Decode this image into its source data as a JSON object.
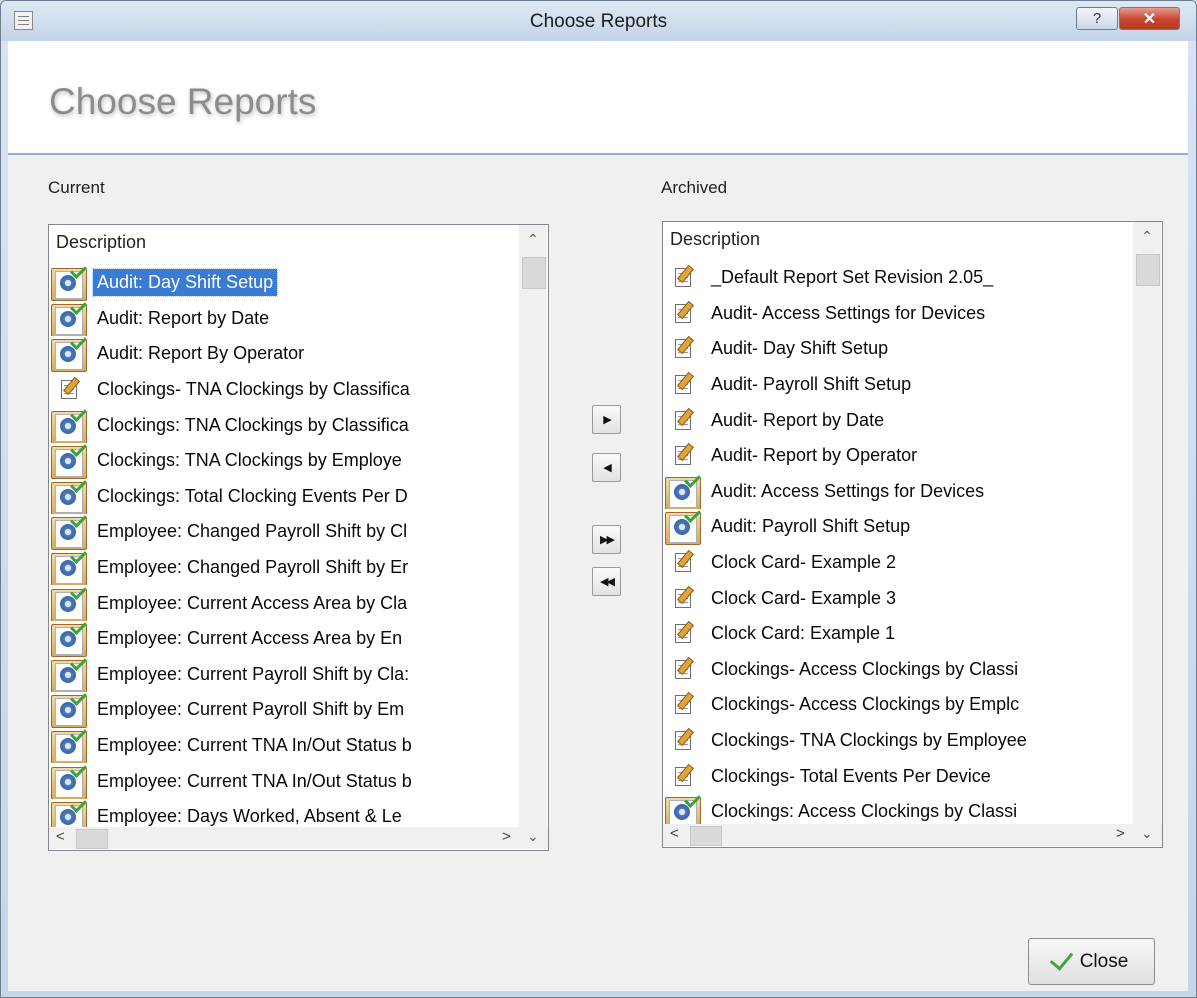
{
  "window": {
    "title": "Choose Reports",
    "help_label": "?",
    "close_label": "✕"
  },
  "header": {
    "title": "Choose Reports"
  },
  "current": {
    "label": "Current",
    "column_header": "Description",
    "items": [
      {
        "icon": "report-check-icon",
        "label": "Audit: Day Shift Setup",
        "selected": true
      },
      {
        "icon": "report-check-icon",
        "label": "Audit: Report by Date"
      },
      {
        "icon": "report-check-icon",
        "label": "Audit: Report By Operator"
      },
      {
        "icon": "report-edit-icon",
        "label": "Clockings- TNA Clockings by Classifica"
      },
      {
        "icon": "report-check-icon",
        "label": "Clockings: TNA Clockings by Classifica"
      },
      {
        "icon": "report-check-icon",
        "label": "Clockings: TNA Clockings by Employe"
      },
      {
        "icon": "report-check-icon",
        "label": "Clockings: Total Clocking Events Per D"
      },
      {
        "icon": "report-check-icon",
        "label": "Employee: Changed Payroll Shift by Cl"
      },
      {
        "icon": "report-check-icon",
        "label": "Employee: Changed Payroll Shift by Er"
      },
      {
        "icon": "report-check-icon",
        "label": "Employee: Current Access Area by Cla"
      },
      {
        "icon": "report-check-icon",
        "label": "Employee: Current Access Area by En"
      },
      {
        "icon": "report-check-icon",
        "label": "Employee: Current Payroll Shift by Cla:"
      },
      {
        "icon": "report-check-icon",
        "label": "Employee: Current Payroll Shift by Em"
      },
      {
        "icon": "report-check-icon",
        "label": "Employee: Current TNA In/Out Status b"
      },
      {
        "icon": "report-check-icon",
        "label": "Employee: Current TNA In/Out Status b"
      },
      {
        "icon": "report-check-icon",
        "label": "Employee: Days Worked, Absent & Le"
      }
    ]
  },
  "archived": {
    "label": "Archived",
    "column_header": "Description",
    "items": [
      {
        "icon": "report-edit-icon",
        "label": "_Default Report Set Revision 2.05_"
      },
      {
        "icon": "report-edit-icon",
        "label": "Audit- Access Settings for Devices"
      },
      {
        "icon": "report-edit-icon",
        "label": "Audit- Day Shift Setup"
      },
      {
        "icon": "report-edit-icon",
        "label": "Audit- Payroll Shift Setup"
      },
      {
        "icon": "report-edit-icon",
        "label": "Audit- Report by Date"
      },
      {
        "icon": "report-edit-icon",
        "label": "Audit- Report by Operator"
      },
      {
        "icon": "report-check-icon",
        "label": "Audit: Access Settings for Devices"
      },
      {
        "icon": "report-check-icon",
        "label": "Audit: Payroll Shift Setup"
      },
      {
        "icon": "report-edit-icon",
        "label": "Clock Card- Example 2"
      },
      {
        "icon": "report-edit-icon",
        "label": "Clock Card- Example 3"
      },
      {
        "icon": "report-edit-icon",
        "label": "Clock Card: Example 1"
      },
      {
        "icon": "report-edit-icon",
        "label": "Clockings- Access Clockings by Classi"
      },
      {
        "icon": "report-edit-icon",
        "label": "Clockings- Access Clockings by Emplc"
      },
      {
        "icon": "report-edit-icon",
        "label": "Clockings- TNA Clockings by Employee"
      },
      {
        "icon": "report-edit-icon",
        "label": "Clockings- Total Events Per Device"
      },
      {
        "icon": "report-check-icon",
        "label": "Clockings: Access Clockings by Classi"
      }
    ]
  },
  "move_buttons": {
    "move_right": "▶",
    "move_left": "◀",
    "move_all_right": "▶▶",
    "move_all_left": "◀◀"
  },
  "footer": {
    "close_label": "Close"
  }
}
